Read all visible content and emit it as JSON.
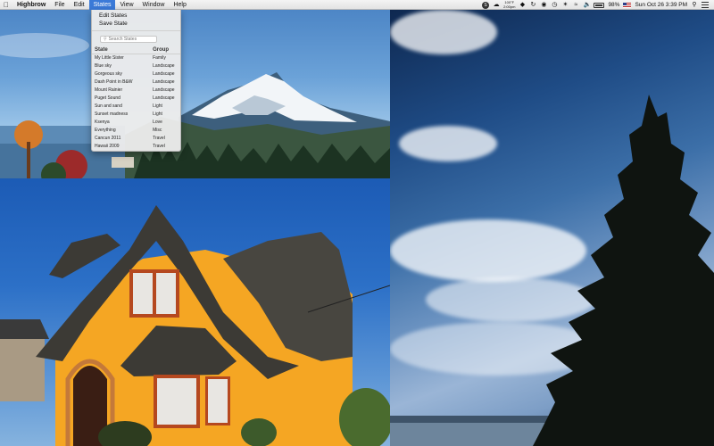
{
  "menubar": {
    "app_name": "Highbrow",
    "menus": [
      "File",
      "Edit",
      "States",
      "View",
      "Window",
      "Help"
    ],
    "active_menu": "States",
    "status": {
      "weather_temp": "100°F",
      "weather_time": "2:00pm",
      "battery": "98%",
      "datetime": "Sun Oct 26  3:39 PM"
    }
  },
  "states_menu": {
    "actions": [
      "Edit States",
      "Save State"
    ],
    "search_placeholder": "Search States",
    "columns": {
      "state": "State",
      "group": "Group"
    },
    "rows": [
      {
        "state": "My Little Sister",
        "group": "Family"
      },
      {
        "state": "Blue sky",
        "group": "Landscape"
      },
      {
        "state": "Gorgeous sky",
        "group": "Landscape"
      },
      {
        "state": "Dash Point in B&W",
        "group": "Landscape"
      },
      {
        "state": "Mount Rainier",
        "group": "Landscape"
      },
      {
        "state": "Puget Sound",
        "group": "Landscape"
      },
      {
        "state": "Sun and sand",
        "group": "Light"
      },
      {
        "state": "Sunset madness",
        "group": "Light"
      },
      {
        "state": "Ksenya",
        "group": "Love"
      },
      {
        "state": "Everything",
        "group": "Misc"
      },
      {
        "state": "Cancun 2011",
        "group": "Travel"
      },
      {
        "state": "Hawaii 2009",
        "group": "Travel"
      }
    ]
  },
  "colors": {
    "menu_highlight": "#3b7ad8",
    "house_yellow": "#f5a623"
  }
}
